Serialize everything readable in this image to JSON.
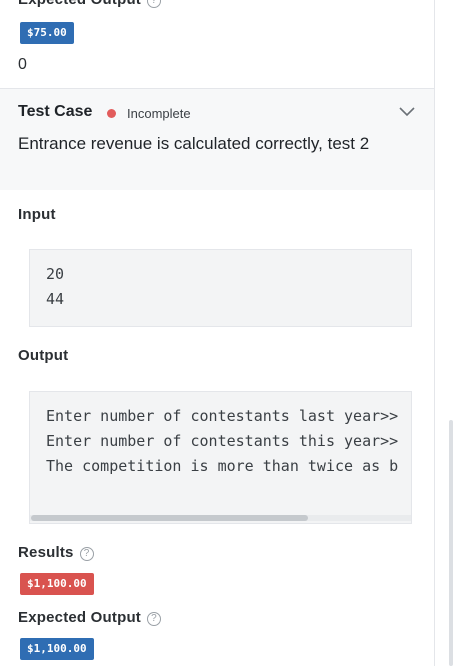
{
  "top": {
    "expected_label": "Expected Output",
    "expected_badge": "$75.00",
    "expected_value": "0"
  },
  "test_case": {
    "title": "Test Case",
    "status": "Incomplete",
    "description": "Entrance revenue is calculated correctly, test 2"
  },
  "input": {
    "label": "Input",
    "lines": [
      "20",
      "44"
    ]
  },
  "output": {
    "label": "Output",
    "lines": [
      "Enter number of contestants last year>>",
      "Enter number of contestants this year>>",
      "The competition is more than twice as b"
    ],
    "scroll_fraction": 0.72
  },
  "results": {
    "label": "Results",
    "badge": "$1,100.00"
  },
  "expected": {
    "label": "Expected Output",
    "badge": "$1,100.00"
  },
  "colors": {
    "badge_blue": "#2f6db3",
    "badge_red": "#d9534f",
    "status_incomplete": "#e25c5c"
  },
  "icons": [
    "help-icon",
    "chevron-down-icon",
    "status-dot-icon"
  ]
}
